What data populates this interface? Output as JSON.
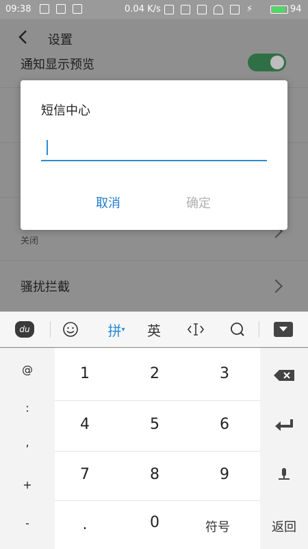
{
  "status_bar": {
    "time": "09:38",
    "speed": "0.04 K/s",
    "battery": "94",
    "battery_level": 0.94
  },
  "app_bar": {
    "title": "设置"
  },
  "settings": {
    "rows": [
      {
        "label": "通知显示预览"
      },
      {
        "sub": "关闭"
      },
      {
        "label": "骚扰拦截"
      }
    ]
  },
  "dialog": {
    "title": "短信中心",
    "input_value": "",
    "cancel_label": "取消",
    "ok_label": "确定"
  },
  "keyboard": {
    "toolbar": {
      "logo": "du",
      "pinyin": "拼",
      "english": "英"
    },
    "symbols": [
      "@",
      ":",
      ",",
      "+",
      "-"
    ],
    "digits": [
      [
        "1",
        "2",
        "3"
      ],
      [
        "4",
        "5",
        "6"
      ],
      [
        "7",
        "8",
        "9"
      ],
      [
        ".",
        "0",
        ""
      ]
    ],
    "fuhao_label": "符号",
    "fanhui_label": "返回"
  },
  "colors": {
    "accent": "#1f7bd0",
    "toggle_on": "#2f6f45"
  }
}
